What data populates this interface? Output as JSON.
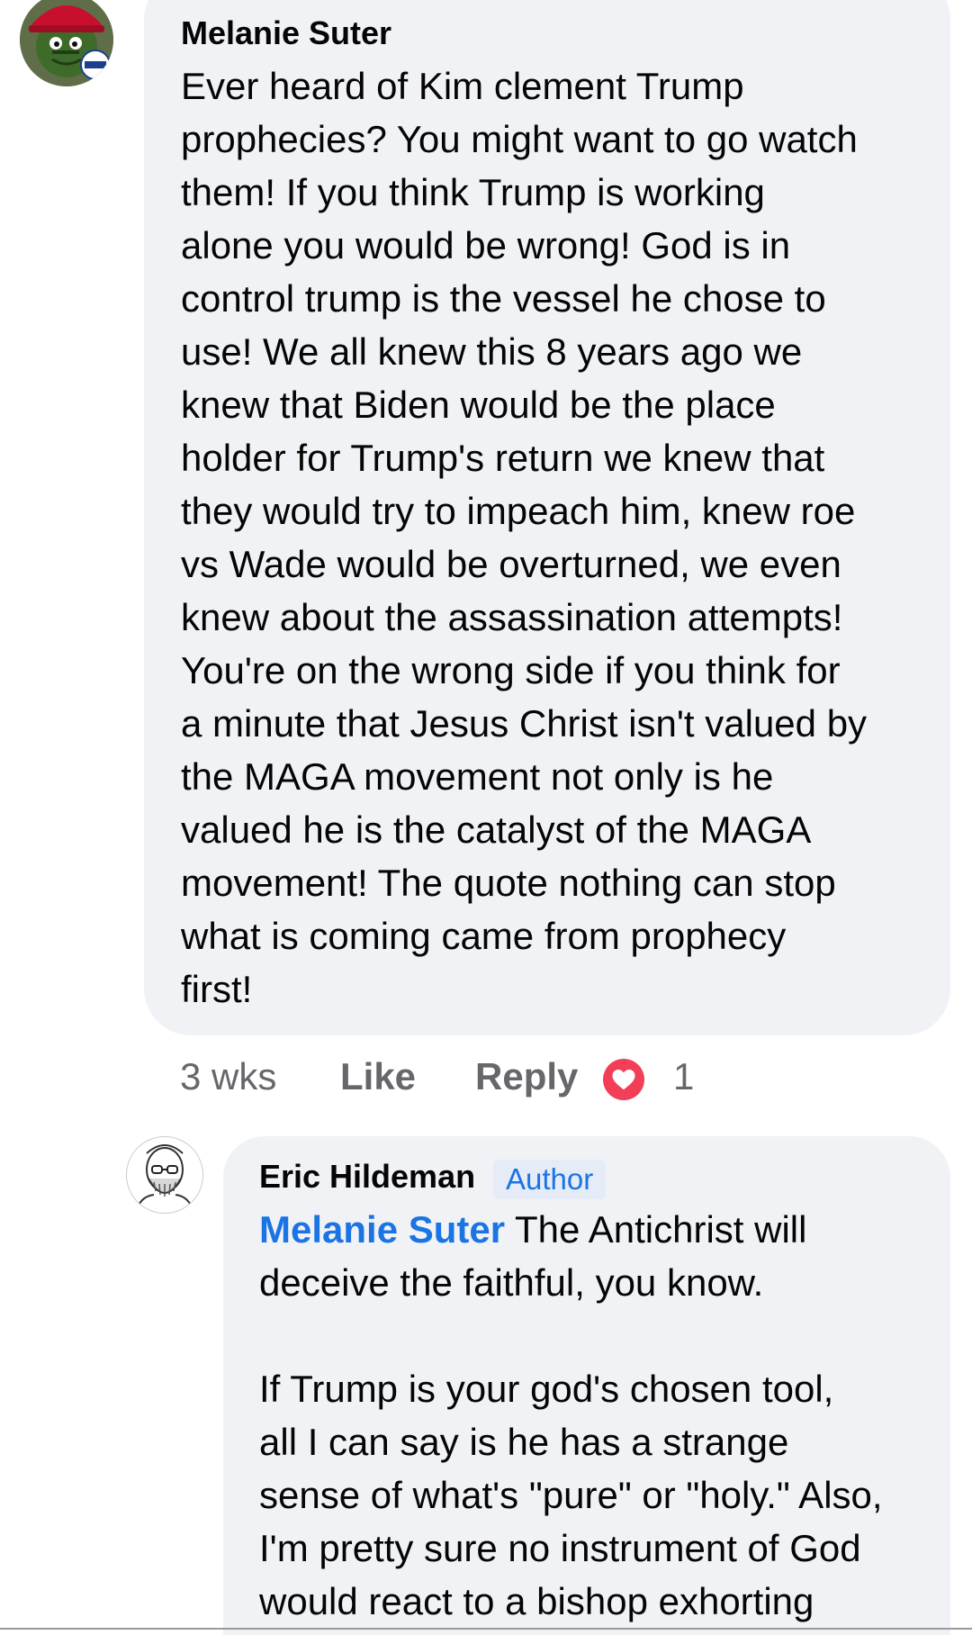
{
  "comment": {
    "author": "Melanie Suter",
    "avatar_icon": "oscar-grouch-maga-hat-vote-avatar",
    "avatar_badge": "VOTE!",
    "body_lines": [
      "Ever heard of Kim clement Trump",
      "prophecies? You might want to go watch",
      "them! If you think Trump is working",
      "alone you would be wrong! God is in",
      "control trump is the vessel he chose to",
      "use! We all knew this 8 years ago we",
      "knew that Biden would be the place",
      "holder for Trump's return we knew that",
      "they would try to impeach him, knew roe",
      "vs Wade would be overturned, we even",
      "knew about the assassination attempts!",
      "You're on the wrong side if you think for",
      "a minute that Jesus Christ isn't valued by",
      "the MAGA movement not only is he",
      "valued he is the catalyst of the MAGA",
      "movement! The quote nothing can stop",
      "what is coming came from prophecy",
      "first!"
    ],
    "time": "3 wks",
    "like_label": "Like",
    "reply_label": "Reply",
    "reaction_icon": "heart-reaction-icon",
    "reaction_count": "1",
    "reaction_color": "#f33e58"
  },
  "reply": {
    "author": "Eric Hildeman",
    "badge": "Author",
    "avatar_icon": "sketched-bearded-man-avatar",
    "mention": "Melanie Suter",
    "first_line_rest": " The Antichrist will",
    "body_lines": [
      "deceive the faithful, you know.",
      "",
      "If Trump is your god's chosen tool,",
      "all I can say is he has a strange",
      "sense of what's \"pure\" or \"holy.\" Also,",
      "I'm pretty sure no instrument of God",
      "would react to a bishop exhorting"
    ]
  },
  "colors": {
    "bubble": "#f0f2f5",
    "link": "#1b74e4",
    "meta_text": "#65676b",
    "badge_bg": "#e6ecf7"
  }
}
